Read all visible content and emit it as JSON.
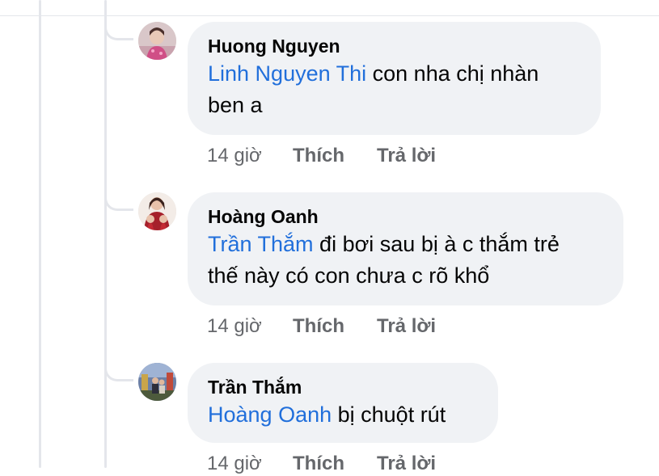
{
  "comments": [
    {
      "author": "Huong Nguyen",
      "mention": "Linh Nguyen Thi",
      "text_line1": " con nha chị nhàn",
      "text_line2": "ben a",
      "time": "14 giờ",
      "like": "Thích",
      "reply": "Trả lời"
    },
    {
      "author": "Hoàng Oanh",
      "mention": "Trần Thắm",
      "text_line1": " đi bơi sau bị à c thắm trẻ",
      "text_line2": "thế này có con chưa c rõ khổ",
      "time": "14 giờ",
      "like": "Thích",
      "reply": "Trả lời"
    },
    {
      "author": "Trần Thắm",
      "mention": "Hoàng Oanh",
      "text_line1": " bị chuột rút",
      "time": "14 giờ",
      "like": "Thích",
      "reply": "Trả lời"
    }
  ],
  "colors": {
    "mention": "#216fdb",
    "bubble": "#f0f2f5",
    "meta": "#65676b",
    "thread_line": "#e4e6eb"
  }
}
